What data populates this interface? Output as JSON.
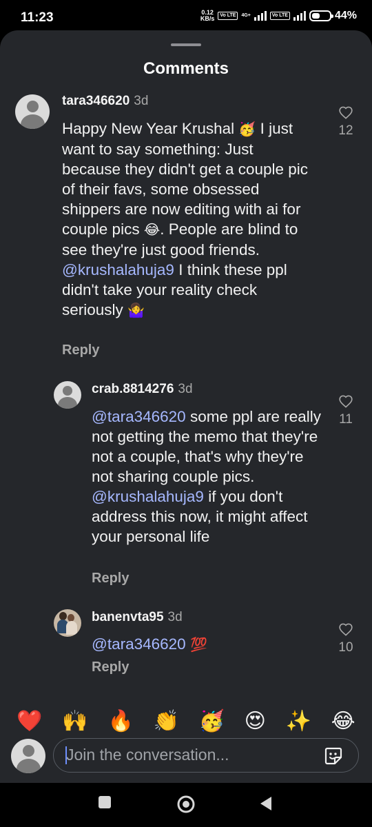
{
  "status_bar": {
    "time": "11:23",
    "net_speed_value": "0.12",
    "net_speed_unit": "KB/s",
    "sim1_chip": "Vo LTE",
    "sim1_tech": "4G+",
    "sim2_chip": "Vo LTE",
    "battery_percent": "44%",
    "battery_level": 0.44
  },
  "sheet": {
    "title": "Comments"
  },
  "comments": [
    {
      "username": "tara346620",
      "time": "3d",
      "text_1": "Happy New Year Krushal ",
      "emoji_1": "🥳",
      "text_2": " I just want to say something: Just because they didn't get a couple pic of their favs, some obsessed shippers are now editing with ai for couple pics ",
      "emoji_2": "😂",
      "text_3": ". People are blind to see they're just good friends. ",
      "mention": "@krushalahuja9",
      "text_4": " I think these ppl didn't take your reality check seriously ",
      "emoji_3": "🤷‍♀️",
      "reply_label": "Reply",
      "likes": "12"
    },
    {
      "username": "crab.8814276",
      "time": "3d",
      "mention_1": "@tara346620",
      "text_1": " some ppl are really not getting the memo that they're not a couple, that's why they're not sharing couple pics. ",
      "mention_2": "@krushalahuja9",
      "text_2": " if you don't address this now, it might affect your personal life",
      "reply_label": "Reply",
      "likes": "11"
    },
    {
      "username": "banenvta95",
      "time": "3d",
      "mention_1": "@tara346620",
      "emoji_1": " 💯",
      "reply_label": "Reply",
      "likes": "10"
    }
  ],
  "reactions": [
    "❤️",
    "🙌",
    "🔥",
    "👏",
    "🥳",
    "😍",
    "✨",
    "😂"
  ],
  "composer": {
    "placeholder": "Join the conversation..."
  },
  "icons": {
    "like": "heart-outline-icon",
    "sticker": "sticker-icon",
    "nav_recents": "square-icon",
    "nav_home": "circle-icon",
    "nav_back": "triangle-back-icon"
  },
  "colors": {
    "sheet_bg": "#25272b",
    "mention": "#a6b8ff",
    "muted": "#a8a8a8"
  }
}
